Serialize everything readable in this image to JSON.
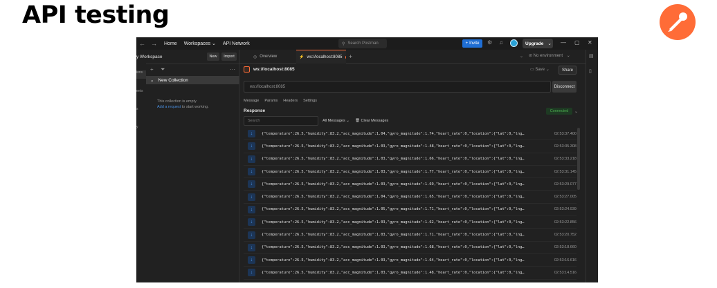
{
  "slide": {
    "title": "API testing"
  },
  "titlebar": {
    "home": "Home",
    "workspaces": "Workspaces",
    "api_network": "API Network",
    "search_placeholder": "Search Postman",
    "invite": "Invite",
    "upgrade": "Upgrade"
  },
  "sidebar": {
    "workspace_name": "y Workspace",
    "new_btn": "New",
    "import_btn": "Import",
    "rail": [
      "ions",
      "ents",
      "s",
      "y"
    ],
    "collection": "New Collection",
    "empty_text": "This collection is empty",
    "add_request": "Add a request",
    "start_text": "to start working."
  },
  "tabs": {
    "overview": "Overview",
    "ws_tab": "ws://localhost:8085",
    "environment": "No environment"
  },
  "request": {
    "title": "ws://localhost:8085",
    "save": "Save",
    "share": "Share",
    "url": "ws://localhost:8085",
    "disconnect": "Disconnect",
    "subtabs": [
      "Message",
      "Params",
      "Headers",
      "Settings"
    ]
  },
  "response": {
    "label": "Response",
    "status": "Connected",
    "search_placeholder": "Search",
    "filter": "All Messages",
    "clear": "Clear Messages",
    "messages": [
      {
        "text": "{\"temperature\":26.5,\"humidity\":83.2,\"acc_magnitude\":1.04,\"gyro_magnitude\":1.74,\"heart_rate\":0,\"location\":{\"lat\":0,\"lng…",
        "time": "02:53:37.400"
      },
      {
        "text": "{\"temperature\":26.5,\"humidity\":83.2,\"acc_magnitude\":1.03,\"gyro_magnitude\":1.48,\"heart_rate\":0,\"location\":{\"lat\":0,\"lng…",
        "time": "02:53:35.308"
      },
      {
        "text": "{\"temperature\":26.5,\"humidity\":83.2,\"acc_magnitude\":1.03,\"gyro_magnitude\":1.66,\"heart_rate\":0,\"location\":{\"lat\":0,\"lng…",
        "time": "02:53:33.218"
      },
      {
        "text": "{\"temperature\":26.5,\"humidity\":83.2,\"acc_magnitude\":1.03,\"gyro_magnitude\":1.77,\"heart_rate\":0,\"location\":{\"lat\":0,\"lng…",
        "time": "02:53:31.145"
      },
      {
        "text": "{\"temperature\":26.5,\"humidity\":83.2,\"acc_magnitude\":1.03,\"gyro_magnitude\":1.69,\"heart_rate\":0,\"location\":{\"lat\":0,\"lng…",
        "time": "02:53:29.077"
      },
      {
        "text": "{\"temperature\":26.5,\"humidity\":83.2,\"acc_magnitude\":1.04,\"gyro_magnitude\":1.65,\"heart_rate\":0,\"location\":{\"lat\":0,\"lng…",
        "time": "02:53:27.005"
      },
      {
        "text": "{\"temperature\":26.5,\"humidity\":83.2,\"acc_magnitude\":1.05,\"gyro_magnitude\":1.71,\"heart_rate\":0,\"location\":{\"lat\":0,\"lng…",
        "time": "02:53:24.939"
      },
      {
        "text": "{\"temperature\":26.5,\"humidity\":83.2,\"acc_magnitude\":1.03,\"gyro_magnitude\":1.62,\"heart_rate\":0,\"location\":{\"lat\":0,\"lng…",
        "time": "02:53:22.856"
      },
      {
        "text": "{\"temperature\":26.5,\"humidity\":83.2,\"acc_magnitude\":1.03,\"gyro_magnitude\":1.71,\"heart_rate\":0,\"location\":{\"lat\":0,\"lng…",
        "time": "02:53:20.752"
      },
      {
        "text": "{\"temperature\":26.5,\"humidity\":83.2,\"acc_magnitude\":1.03,\"gyro_magnitude\":1.68,\"heart_rate\":0,\"location\":{\"lat\":0,\"lng…",
        "time": "02:53:18.660"
      },
      {
        "text": "{\"temperature\":26.5,\"humidity\":83.2,\"acc_magnitude\":1.03,\"gyro_magnitude\":1.64,\"heart_rate\":0,\"location\":{\"lat\":0,\"lng…",
        "time": "02:53:16.616"
      },
      {
        "text": "{\"temperature\":26.5,\"humidity\":83.2,\"acc_magnitude\":1.03,\"gyro_magnitude\":1.48,\"heart_rate\":0,\"location\":{\"lat\":0,\"lng…",
        "time": "02:53:14.516"
      }
    ]
  },
  "colors": {
    "accent": "#ff6c37",
    "invite": "#1f6ed4",
    "connected": "#4caf50",
    "app_bg": "#212121"
  }
}
